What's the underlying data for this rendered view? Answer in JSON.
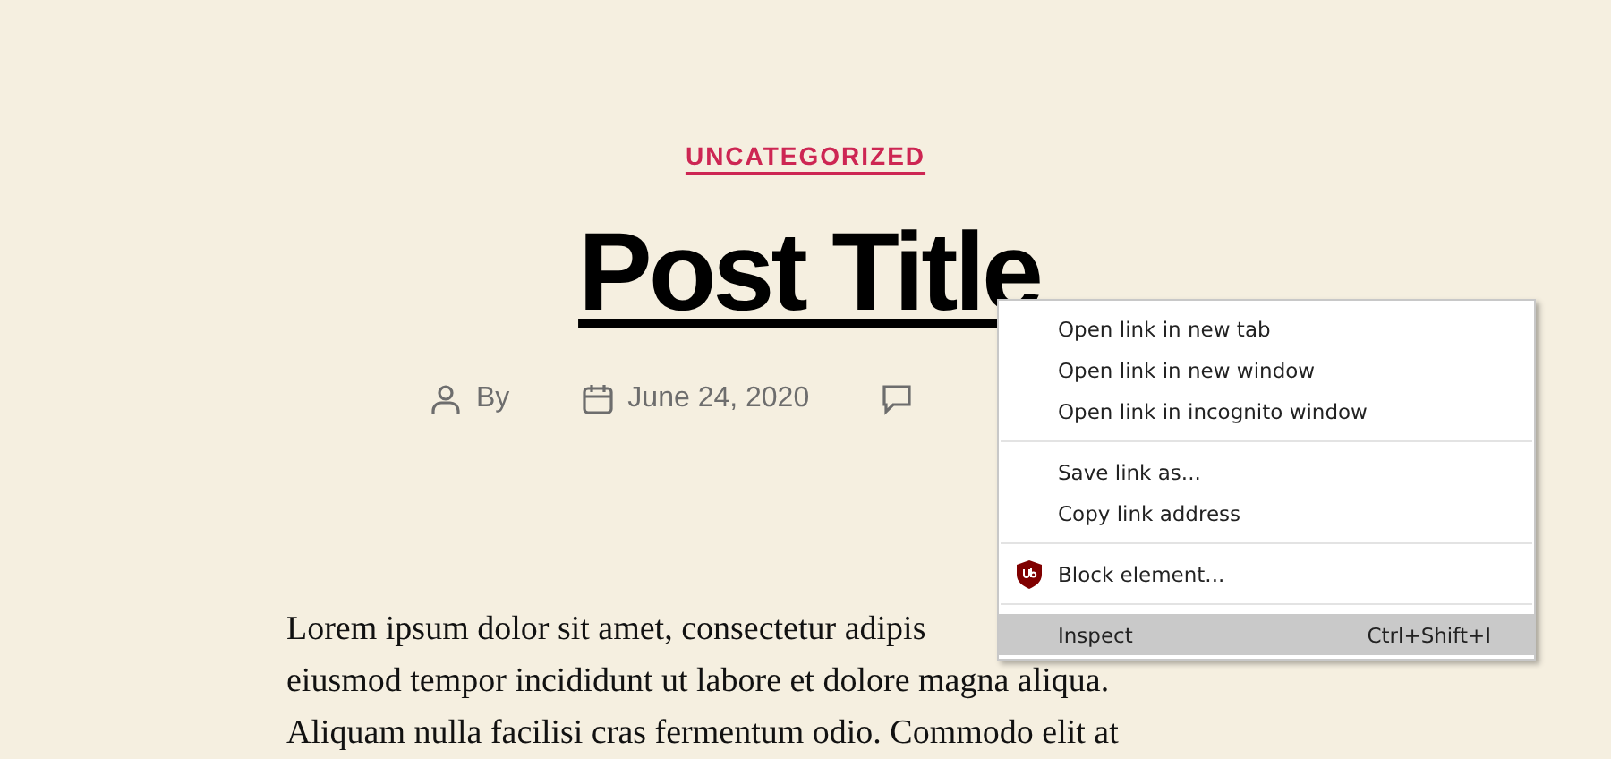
{
  "post": {
    "category": "UNCATEGORIZED",
    "title": "Post Title",
    "meta": [
      {
        "kind": "author",
        "text": "By"
      },
      {
        "kind": "date",
        "text": "June 24, 2020"
      },
      {
        "kind": "comments"
      }
    ],
    "paragraph_lines": [
      "Lorem ipsum dolor sit amet, consectetur adipis",
      "eiusmod tempor incididunt ut labore et dolore magna aliqua.",
      "Aliquam nulla facilisi cras fermentum odio. Commodo elit at"
    ]
  },
  "context_menu": [
    {
      "kind": "item",
      "label": "Open link in new tab",
      "selected": false
    },
    {
      "kind": "item",
      "label": "Open link in new window",
      "selected": false
    },
    {
      "kind": "item",
      "label": "Open link in incognito window",
      "selected": false
    },
    {
      "kind": "separator"
    },
    {
      "kind": "item",
      "label": "Save link as...",
      "selected": false
    },
    {
      "kind": "item",
      "label": "Copy link address",
      "selected": false
    },
    {
      "kind": "separator"
    },
    {
      "kind": "shield_item",
      "label": "Block element...",
      "selected": false
    },
    {
      "kind": "separator"
    },
    {
      "kind": "item",
      "label": "Inspect",
      "shortcut": "Ctrl+Shift+I",
      "selected": true
    }
  ]
}
